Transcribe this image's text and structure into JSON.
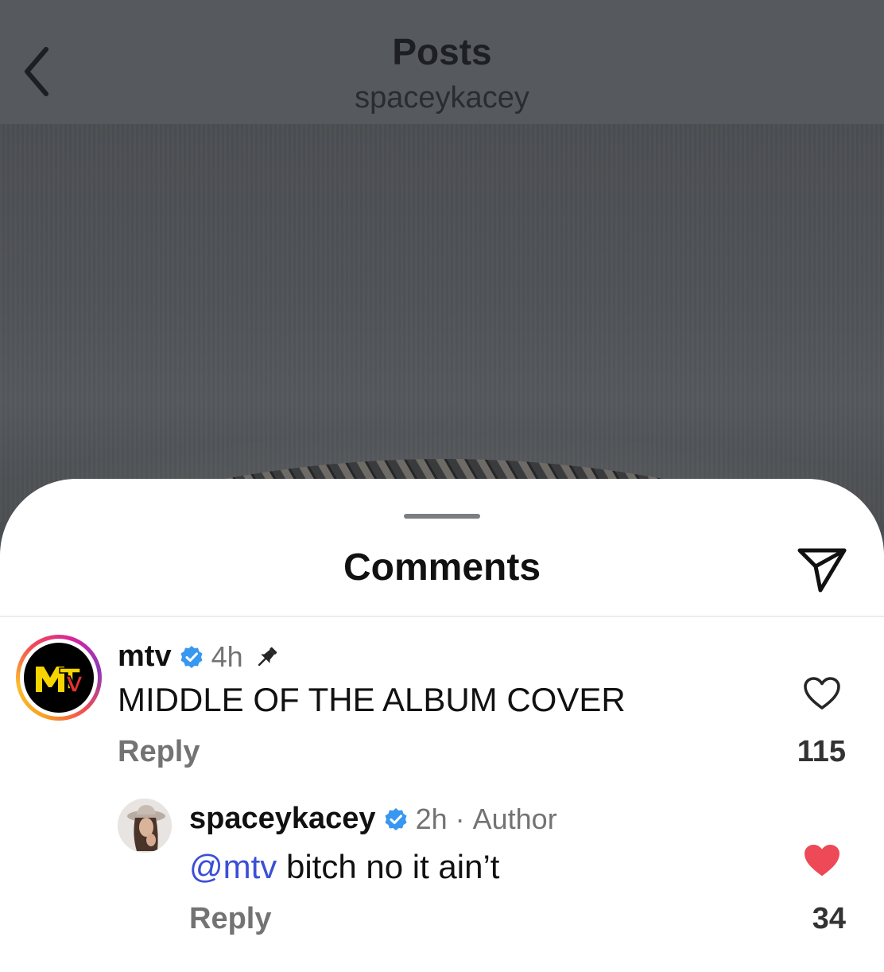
{
  "header": {
    "title": "Posts",
    "subtitle": "spaceykacey"
  },
  "sheet": {
    "title": "Comments"
  },
  "comments": [
    {
      "username": "mtv",
      "verified": true,
      "time": "4h",
      "pinned": true,
      "text": "MIDDLE OF THE ALBUM COVER",
      "reply_label": "Reply",
      "like_count": "115",
      "liked": false,
      "avatar_icon": "mtv-logo-icon"
    },
    {
      "username": "spaceykacey",
      "verified": true,
      "time": "2h",
      "separator": " · ",
      "author_label": "Author",
      "mention": "@mtv",
      "text": " bitch no it ain’t",
      "reply_label": "Reply",
      "like_count": "34",
      "liked": true,
      "avatar_icon": "user-avatar"
    }
  ],
  "colors": {
    "verified_blue": "#3897f0",
    "mention_blue": "#3b4fd6",
    "like_red": "#ed4956",
    "secondary_text": "#737373"
  }
}
